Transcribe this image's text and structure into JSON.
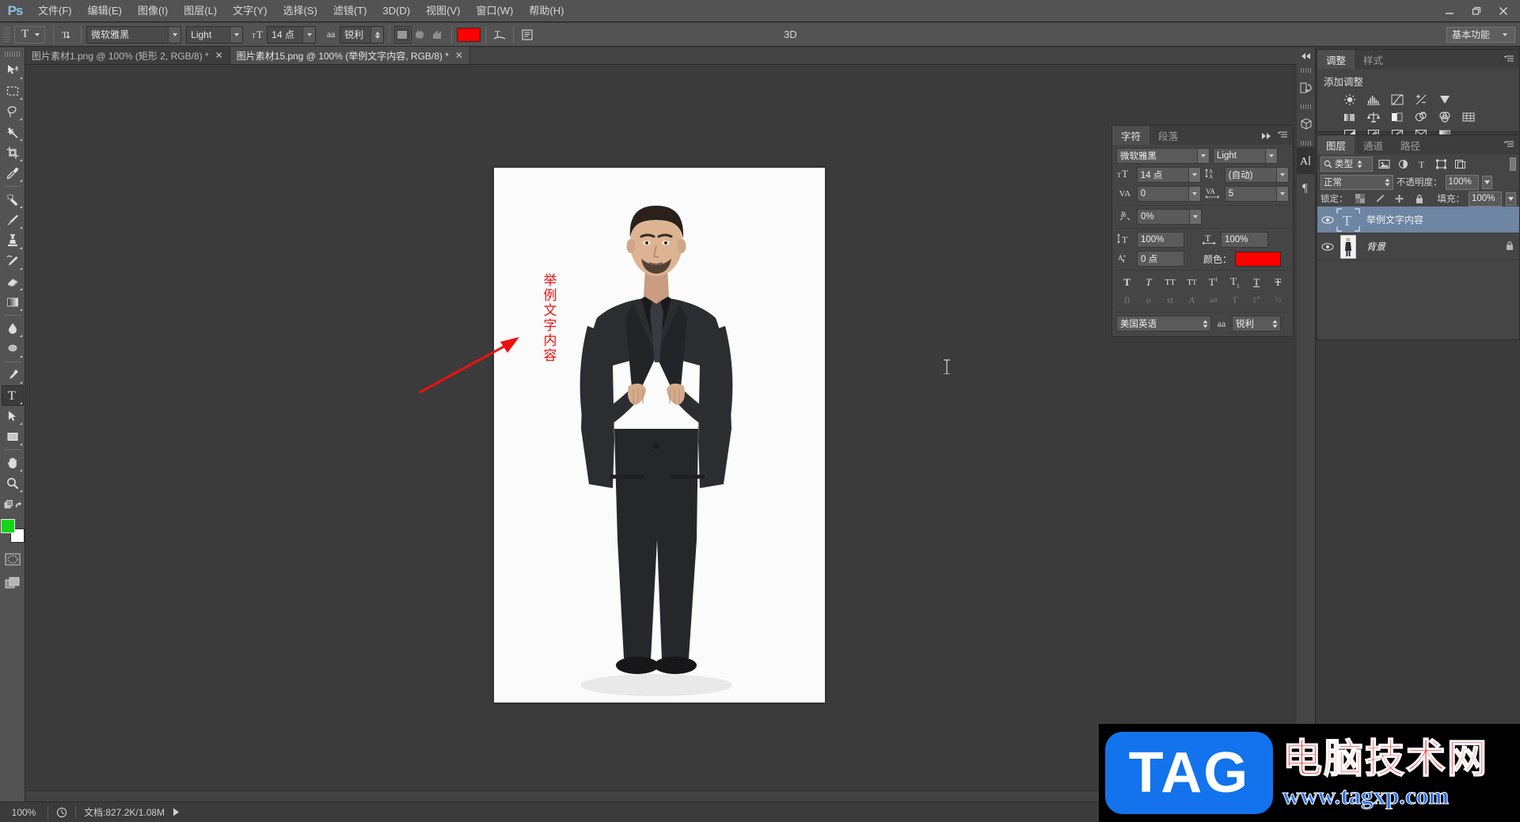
{
  "app": {
    "logo": "Ps",
    "name": "Adobe Photoshop"
  },
  "menubar": {
    "items": [
      {
        "label": "文件(F)",
        "name": "menu-file"
      },
      {
        "label": "编辑(E)",
        "name": "menu-edit"
      },
      {
        "label": "图像(I)",
        "name": "menu-image"
      },
      {
        "label": "图层(L)",
        "name": "menu-layer"
      },
      {
        "label": "文字(Y)",
        "name": "menu-type"
      },
      {
        "label": "选择(S)",
        "name": "menu-select"
      },
      {
        "label": "滤镜(T)",
        "name": "menu-filter"
      },
      {
        "label": "3D(D)",
        "name": "menu-3d"
      },
      {
        "label": "视图(V)",
        "name": "menu-view"
      },
      {
        "label": "窗口(W)",
        "name": "menu-window"
      },
      {
        "label": "帮助(H)",
        "name": "menu-help"
      }
    ],
    "window_controls": [
      "minimize",
      "restore",
      "close"
    ]
  },
  "options_bar": {
    "tool_glyph": "T",
    "orientation_icon": "text-orientation-icon",
    "font_family": "微软雅黑",
    "font_style": "Light",
    "font_size": "14 点",
    "antialias_icon": "aa",
    "antialias_value": "锐利",
    "align": [
      "align-left",
      "align-center",
      "align-right"
    ],
    "align_selected": 0,
    "color_swatch": "#ff0000",
    "warp_icon": "warp-text-icon",
    "panel_icon": "toggle-character-panel-icon",
    "three_d_label": "3D",
    "workspace": "基本功能"
  },
  "tabs": [
    {
      "label": "图片素材1.png @ 100% (矩形 2, RGB/8) *",
      "active": false,
      "name": "tab-doc1"
    },
    {
      "label": "图片素材15.png @ 100% (举例文字内容, RGB/8) *",
      "active": true,
      "name": "tab-doc2"
    }
  ],
  "toolbar": {
    "tools": [
      {
        "name": "move-tool",
        "glyph": "move"
      },
      {
        "name": "rectangular-marquee-tool",
        "glyph": "marquee"
      },
      {
        "name": "lasso-tool",
        "glyph": "lasso"
      },
      {
        "name": "magic-wand-tool",
        "glyph": "wand"
      },
      {
        "name": "crop-tool",
        "glyph": "crop"
      },
      {
        "name": "eyedropper-tool",
        "glyph": "eyedropper"
      },
      {
        "name": "spot-healing-brush-tool",
        "glyph": "healing"
      },
      {
        "name": "brush-tool",
        "glyph": "brush"
      },
      {
        "name": "clone-stamp-tool",
        "glyph": "stamp"
      },
      {
        "name": "history-brush-tool",
        "glyph": "historybrush"
      },
      {
        "name": "eraser-tool",
        "glyph": "eraser"
      },
      {
        "name": "gradient-tool",
        "glyph": "gradient"
      },
      {
        "name": "blur-tool",
        "glyph": "blur"
      },
      {
        "name": "dodge-tool",
        "glyph": "dodge"
      },
      {
        "name": "pen-tool",
        "glyph": "pen"
      },
      {
        "name": "horizontal-type-tool",
        "glyph": "type",
        "selected": true
      },
      {
        "name": "path-selection-tool",
        "glyph": "pathsel"
      },
      {
        "name": "rectangle-tool",
        "glyph": "rect"
      },
      {
        "name": "hand-tool",
        "glyph": "hand"
      },
      {
        "name": "zoom-tool",
        "glyph": "zoom"
      }
    ],
    "foreground_color": "#14d614",
    "background_color": "#ffffff",
    "quickmask_icon": "quick-mask-icon",
    "screenmode_icon": "screen-mode-icon"
  },
  "canvas": {
    "document_text": [
      "举",
      "例",
      "文",
      "字",
      "内",
      "容"
    ],
    "text_color": "#ee1111",
    "annotation_arrow": "red-arrow-annotation",
    "text_cursor": "text-insertion-cursor"
  },
  "dock_rail": {
    "items": [
      {
        "name": "history-panel-icon",
        "glyph": "history"
      },
      {
        "name": "3d-panel-icon",
        "glyph": "cube"
      },
      {
        "name": "character-panel-icon",
        "glyph": "A|",
        "selected": true
      },
      {
        "name": "paragraph-panel-icon",
        "glyph": "¶"
      }
    ],
    "collapse_left": "collapse-dock-icon",
    "expand_right": "expand-dock-icon"
  },
  "adjustments_panel": {
    "tabs": [
      {
        "label": "调整",
        "active": true
      },
      {
        "label": "样式",
        "active": false
      }
    ],
    "title": "添加调整",
    "icons": [
      "brightness-contrast-icon",
      "levels-icon",
      "curves-icon",
      "exposure-icon",
      "vibrance-icon",
      "hue-saturation-icon",
      "color-balance-icon",
      "black-white-icon",
      "photo-filter-icon",
      "channel-mixer-icon",
      "color-lookup-icon",
      "invert-icon",
      "posterize-icon",
      "threshold-icon",
      "gradient-map-icon",
      "selective-color-icon"
    ]
  },
  "layers_panel": {
    "tabs": [
      {
        "label": "图层",
        "active": true
      },
      {
        "label": "通道",
        "active": false
      },
      {
        "label": "路径",
        "active": false
      }
    ],
    "filter_label": "类型",
    "filter_icons": [
      "filter-pixel-icon",
      "filter-adjustment-icon",
      "filter-type-icon",
      "filter-shape-icon",
      "filter-smart-icon"
    ],
    "blend_mode": "正常",
    "opacity_label": "不透明度：",
    "opacity_value": "100%",
    "lock_label": "锁定：",
    "lock_icons": [
      "lock-transparent-icon",
      "lock-image-icon",
      "lock-position-icon",
      "lock-all-icon"
    ],
    "fill_label": "填充：",
    "fill_value": "100%",
    "layers": [
      {
        "name": "举例文字内容",
        "kind": "type",
        "visible": true,
        "selected": true,
        "locked": false
      },
      {
        "name": "背景",
        "kind": "image",
        "visible": true,
        "selected": false,
        "locked": true
      }
    ]
  },
  "character_panel": {
    "tabs": [
      {
        "label": "字符",
        "active": true
      },
      {
        "label": "段落",
        "active": false
      }
    ],
    "font_family": "微软雅黑",
    "font_style": "Light",
    "font_size_icon": "font-size-icon",
    "font_size": "14 点",
    "leading_icon": "leading-icon",
    "leading": "(自动)",
    "kerning_icon": "VA",
    "kerning": "0",
    "tracking_icon": "VA",
    "tracking": "5",
    "tsume_icon": "tsume-icon",
    "tsume": "0%",
    "vscale_icon": "vertical-scale-icon",
    "vertical_scale": "100%",
    "hscale_icon": "horizontal-scale-icon",
    "horizontal_scale": "100%",
    "baseline_icon": "baseline-shift-icon",
    "baseline_shift": "0 点",
    "color_label": "颜色：",
    "color_value": "#ff0000",
    "style_buttons": [
      "faux-bold",
      "faux-italic",
      "all-caps",
      "small-caps",
      "superscript",
      "subscript",
      "underline",
      "strikethrough"
    ],
    "opentype_buttons": [
      "ligatures",
      "contextual-alternates",
      "discretionary-ligatures",
      "swash",
      "titling-alternates",
      "ordinals",
      "fractions-st",
      "fractions-half"
    ],
    "language": "美国英语",
    "antialias_icon": "aa",
    "antialias": "锐利"
  },
  "status_bar": {
    "zoom": "100%",
    "doc_info": "文档:827.2K/1.08M",
    "arrow_icon": "status-expand-arrow"
  },
  "watermark": {
    "badge": "TAG",
    "site_cn": "电脑技术网",
    "url": "www.tagxp.com",
    "badge_color": "#1273ec",
    "cn_color": "#f41414",
    "url_color": "#2a6fe8"
  }
}
